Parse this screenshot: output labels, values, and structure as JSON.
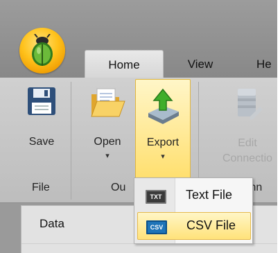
{
  "tabs": [
    {
      "label": "Home",
      "selected": true
    },
    {
      "label": "View",
      "selected": false
    },
    {
      "label": "He",
      "selected": false
    }
  ],
  "ribbon": {
    "buttons": {
      "save": {
        "label": "Save",
        "icon": "floppy-disk-icon"
      },
      "open": {
        "label": "Open",
        "icon": "folder-open-icon",
        "arrow": "▾"
      },
      "export": {
        "label": "Export",
        "icon": "export-upload-icon",
        "arrow": "▾",
        "active": true
      },
      "edit_connection": {
        "label_line1": "Edit",
        "label_line2": "Connectio",
        "icon": "database-edit-icon",
        "enabled": false
      }
    },
    "groups": {
      "file": "File",
      "output": "Ou",
      "connection": "Conn"
    }
  },
  "dropdown": {
    "items": [
      {
        "label": "Text File",
        "badge": "TXT",
        "icon": "text-file-icon"
      },
      {
        "label": "CSV File",
        "badge": "CSV",
        "icon": "csv-file-icon",
        "highlighted": true
      }
    ]
  },
  "lower_panel": {
    "tab": "Data"
  },
  "colors": {
    "accent": "#ffe27a",
    "app_button": "#ffc21c",
    "ribbon": "#cfcfcf"
  }
}
